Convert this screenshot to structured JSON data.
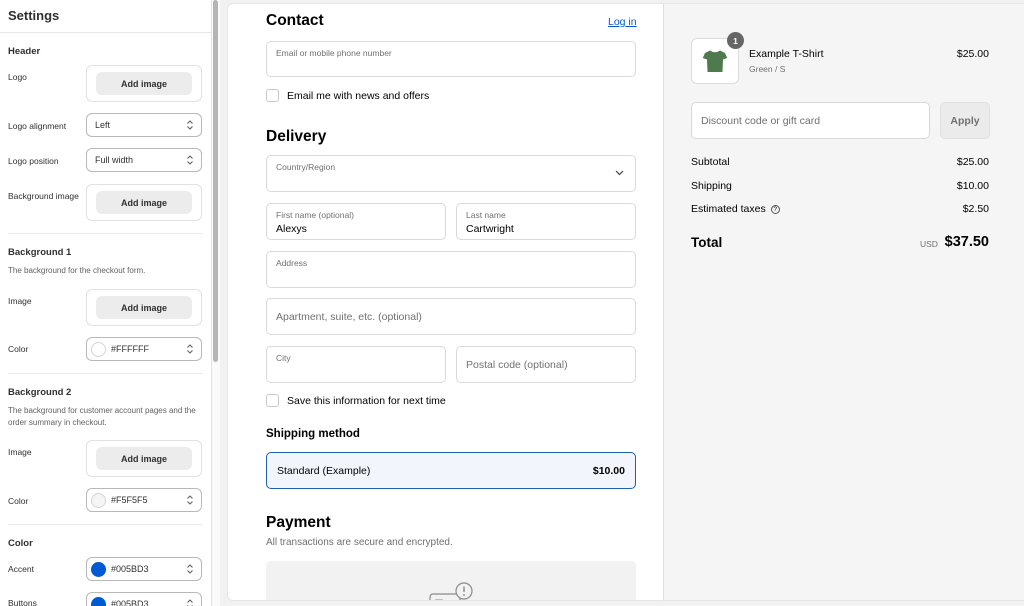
{
  "sidebar": {
    "title": "Settings",
    "header": {
      "heading": "Header",
      "logo_label": "Logo",
      "logo_button": "Add image",
      "alignment_label": "Logo alignment",
      "alignment_value": "Left",
      "position_label": "Logo position",
      "position_value": "Full width",
      "bg_image_label": "Background image",
      "bg_image_button": "Add image"
    },
    "background1": {
      "heading": "Background 1",
      "description": "The background for the checkout form.",
      "image_label": "Image",
      "image_button": "Add image",
      "color_label": "Color",
      "color_value": "#FFFFFF",
      "swatch_color": "#FFFFFF"
    },
    "background2": {
      "heading": "Background 2",
      "description": "The background for customer account pages and the order summary in checkout.",
      "image_label": "Image",
      "image_button": "Add image",
      "color_label": "Color",
      "color_value": "#F5F5F5",
      "swatch_color": "#F5F5F5"
    },
    "color": {
      "heading": "Color",
      "accent_label": "Accent",
      "accent_value": "#005BD3",
      "accent_swatch": "#005BD3",
      "buttons_label": "Buttons",
      "buttons_value": "#005BD3",
      "buttons_swatch": "#005BD3"
    }
  },
  "checkout": {
    "contact": {
      "heading": "Contact",
      "login_link": "Log in",
      "email_label": "Email or mobile phone number",
      "newsletter_label": "Email me with news and offers"
    },
    "delivery": {
      "heading": "Delivery",
      "country_label": "Country/Region",
      "first_name_label": "First name (optional)",
      "first_name_value": "Alexys",
      "last_name_label": "Last name",
      "last_name_value": "Cartwright",
      "address_label": "Address",
      "apartment_placeholder": "Apartment, suite, etc. (optional)",
      "city_label": "City",
      "postal_placeholder": "Postal code (optional)",
      "save_info_label": "Save this information for next time"
    },
    "shipping": {
      "heading": "Shipping method",
      "option_name": "Standard (Example)",
      "option_price": "$10.00"
    },
    "payment": {
      "heading": "Payment",
      "subtitle": "All transactions are secure and encrypted."
    }
  },
  "summary": {
    "item": {
      "name": "Example T-Shirt",
      "variant": "Green / S",
      "price": "$25.00",
      "quantity": "1"
    },
    "discount_placeholder": "Discount code or gift card",
    "apply_label": "Apply",
    "subtotal_label": "Subtotal",
    "subtotal_value": "$25.00",
    "shipping_label": "Shipping",
    "shipping_value": "$10.00",
    "taxes_label": "Estimated taxes",
    "taxes_value": "$2.50",
    "total_label": "Total",
    "total_currency": "USD",
    "total_value": "$37.50"
  },
  "colors": {
    "accent": "#005BD3",
    "link": "#005bd3",
    "tshirt": "#4e7a4e"
  }
}
